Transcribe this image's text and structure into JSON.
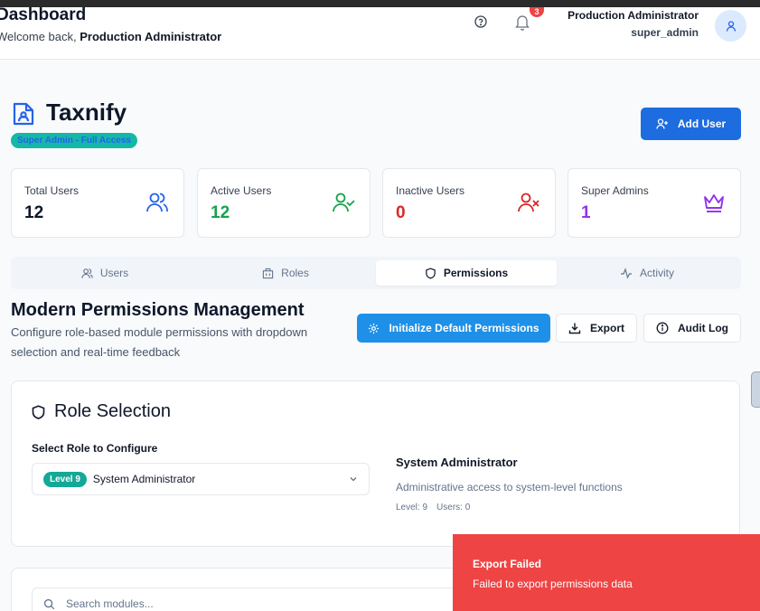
{
  "header": {
    "title": "Dashboard",
    "welcome_prefix": "Welcome back, ",
    "welcome_name": "Production Administrator",
    "notifications_count": "3",
    "user_name": "Production Administrator",
    "user_role": "super_admin"
  },
  "brand": {
    "name": "Taxnify",
    "badge": "Super Admin - Full Access",
    "add_user_label": "Add User"
  },
  "stats": [
    {
      "label": "Total Users",
      "value": "12",
      "color": "#0f172a",
      "icon": "users-icon"
    },
    {
      "label": "Active Users",
      "value": "12",
      "color": "#16a34a",
      "icon": "user-check-icon"
    },
    {
      "label": "Inactive Users",
      "value": "0",
      "color": "#dc2626",
      "icon": "user-x-icon"
    },
    {
      "label": "Super Admins",
      "value": "1",
      "color": "#9333ea",
      "icon": "crown-icon"
    }
  ],
  "tabs": [
    {
      "label": "Users",
      "icon": "users-icon"
    },
    {
      "label": "Roles",
      "icon": "building-icon"
    },
    {
      "label": "Permissions",
      "icon": "shield-icon",
      "active": true
    },
    {
      "label": "Activity",
      "icon": "activity-icon"
    }
  ],
  "permissions": {
    "title": "Modern Permissions Management",
    "description": "Configure role-based module permissions with dropdown selection and real-time feedback",
    "init_label": "Initialize Default Permissions",
    "export_label": "Export",
    "audit_label": "Audit Log"
  },
  "role_selection": {
    "title": "Role Selection",
    "select_label": "Select Role to Configure",
    "level_badge": "Level 9",
    "selected_role": "System Administrator",
    "detail_name": "System Administrator",
    "detail_desc": "Administrative access to system-level functions",
    "detail_level": "Level: 9",
    "detail_users": "Users: 0"
  },
  "search": {
    "placeholder": "Search modules..."
  },
  "toast": {
    "title": "Export Failed",
    "message": "Failed to export permissions data"
  },
  "colors": {
    "primary": "#1d6ce0",
    "accent_teal": "#14b8a6",
    "danger": "#ef4444"
  }
}
